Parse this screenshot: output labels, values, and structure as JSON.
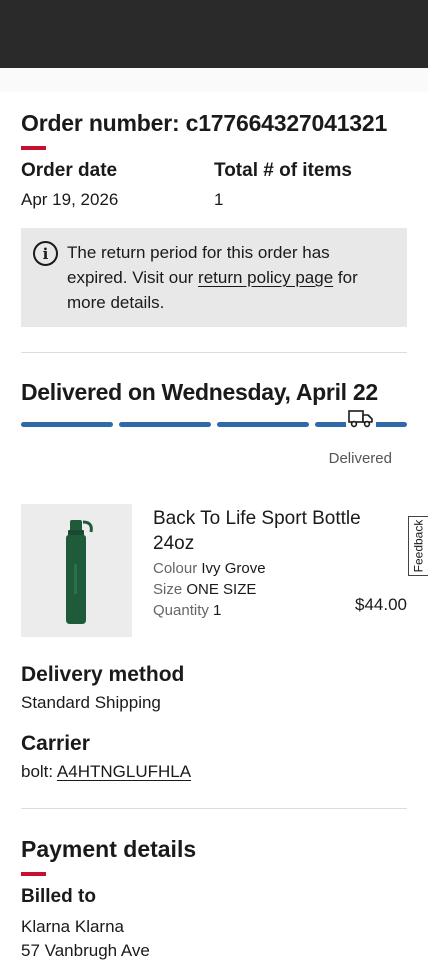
{
  "order": {
    "number_label": "Order number: c177664327041321",
    "date_label": "Order date",
    "date_value": "Apr 19, 2026",
    "items_label": "Total # of items",
    "items_value": "1"
  },
  "notice": {
    "text_before": "The return period for this order has expired. Visit our ",
    "link_text": "return policy page",
    "text_after": " for more details."
  },
  "delivery": {
    "title": "Delivered on Wednesday, April 22",
    "status": "Delivered",
    "progress_steps_completed": 4,
    "progress_steps_total": 4,
    "accent_color": "#2e6aa8"
  },
  "product": {
    "name": "Back To Life Sport Bottle 24oz",
    "colour_label": "Colour",
    "colour_value": "Ivy Grove",
    "size_label": "Size",
    "size_value": "ONE SIZE",
    "qty_label": "Quantity",
    "qty_value": "1",
    "price": "$44.00"
  },
  "delivery_method": {
    "label": "Delivery method",
    "value": "Standard Shipping"
  },
  "carrier": {
    "label": "Carrier",
    "prefix": "bolt: ",
    "tracking": "A4HTNGLUFHLA"
  },
  "payment": {
    "title": "Payment details",
    "billed_to_label": "Billed to",
    "name": "Klarna Klarna",
    "address_line1": "57 Vanbrugh Ave"
  },
  "feedback_label": "Feedback",
  "colors": {
    "brand_red": "#c8102e",
    "notice_bg": "#e8e8e8"
  }
}
